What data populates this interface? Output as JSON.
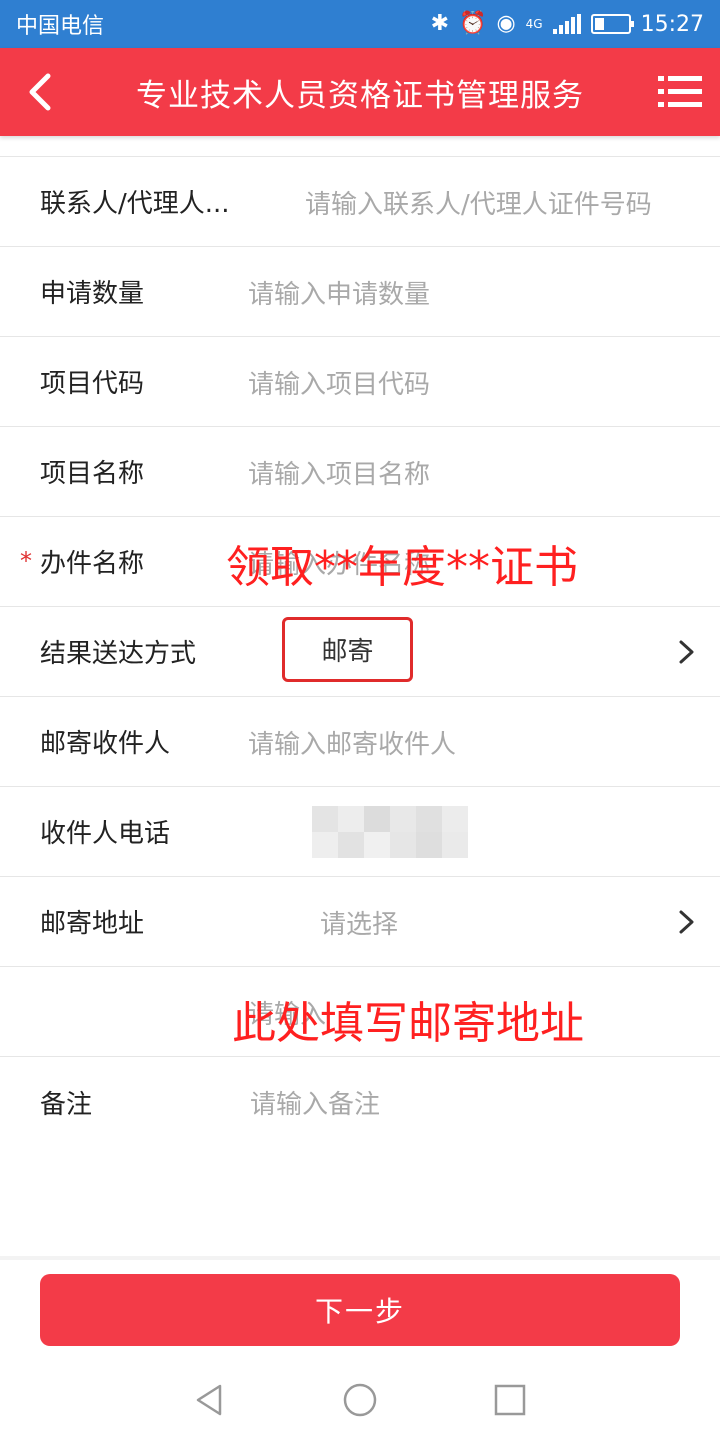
{
  "status_bar": {
    "carrier": "中国电信",
    "network": "4G",
    "time": "15:27"
  },
  "header": {
    "title": "专业技术人员资格证书管理服务"
  },
  "form": {
    "contact_id": {
      "label": "联系人/代理人...",
      "placeholder": "请输入联系人/代理人证件号码"
    },
    "quantity": {
      "label": "申请数量",
      "placeholder": "请输入申请数量"
    },
    "project_code": {
      "label": "项目代码",
      "placeholder": "请输入项目代码"
    },
    "project_name": {
      "label": "项目名称",
      "placeholder": "请输入项目名称"
    },
    "case_name": {
      "required_mark": "*",
      "label": "办件名称",
      "placeholder": "请输入办件名称"
    },
    "delivery": {
      "label": "结果送达方式",
      "value": "邮寄"
    },
    "recipient": {
      "label": "邮寄收件人",
      "placeholder": "请输入邮寄收件人"
    },
    "recipient_phone": {
      "label": "收件人电话"
    },
    "address": {
      "label": "邮寄地址",
      "placeholder": "请选择"
    },
    "address_detail": {
      "placeholder": "请输入"
    },
    "remark": {
      "label": "备注",
      "placeholder": "请输入备注"
    }
  },
  "annotations": {
    "case_name_note": "领取**年度**证书",
    "address_note": "此处填写邮寄地址"
  },
  "buttons": {
    "next": "下一步"
  },
  "colors": {
    "accent": "#f33b48",
    "status_bar": "#2f7fd1",
    "annotation": "#ff2020"
  }
}
